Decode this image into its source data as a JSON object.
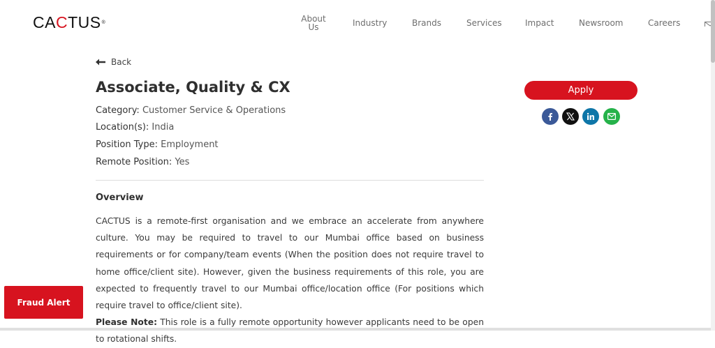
{
  "header": {
    "logo": {
      "pre": "CA",
      "accent": "C",
      "post": "TUS",
      "mark": "®"
    },
    "nav": [
      "About Us",
      "Industry",
      "Brands",
      "Services",
      "Impact",
      "Newsroom",
      "Careers"
    ],
    "nav_about_line1": "About",
    "nav_about_line2": "Us",
    "mail_icon": "mail-icon"
  },
  "job": {
    "back_label": "Back",
    "title": "Associate, Quality & CX",
    "meta": [
      {
        "key": "Category:",
        "value": "Customer Service & Operations"
      },
      {
        "key": "Location(s):",
        "value": "India"
      },
      {
        "key": "Position Type:",
        "value": "Employment"
      },
      {
        "key": "Remote Position:",
        "value": "Yes"
      }
    ],
    "overview_heading": "Overview",
    "overview_text": "CACTUS is a remote-first organisation and we embrace an accelerate from anywhere culture. You may be required to travel to our Mumbai office based on business requirements or for company/team events (When the position does not require travel to home office/client site). However, given the business requirements of this role, you are expected to frequently travel to our Mumbai office/location office (For positions which require travel to office/client site).",
    "note_label": "Please Note:",
    "note_text": " This role is a fully remote opportunity however applicants need to be open to rotational shifts."
  },
  "sidebar": {
    "apply_label": "Apply",
    "share": [
      {
        "icon": "facebook-icon",
        "color": "#3b5998"
      },
      {
        "icon": "x-icon",
        "color": "#111111"
      },
      {
        "icon": "linkedin-icon",
        "color": "#0e76a8"
      },
      {
        "icon": "email-icon",
        "color": "#25b24a"
      }
    ]
  },
  "fraud_alert_label": "Fraud Alert",
  "colors": {
    "brand_red": "#d7131f",
    "text": "#333333",
    "nav": "#6e6e6e"
  }
}
